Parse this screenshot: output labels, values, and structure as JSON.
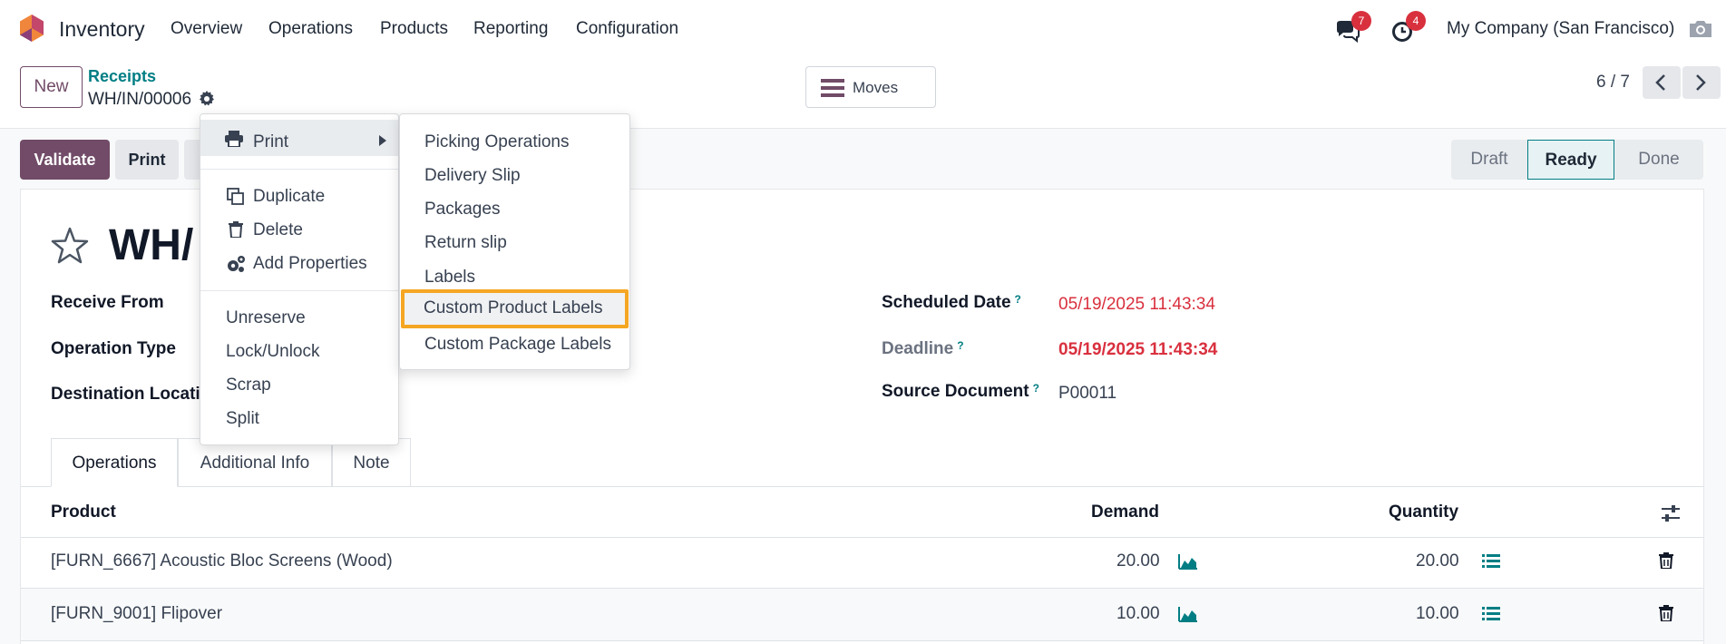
{
  "nav": {
    "app_name": "Inventory",
    "menu": [
      "Overview",
      "Operations",
      "Products",
      "Reporting",
      "Configuration"
    ],
    "messages_count": "7",
    "activities_count": "4",
    "company": "My Company (San Francisco)"
  },
  "control": {
    "new_label": "New",
    "breadcrumb_parent": "Receipts",
    "breadcrumb_current": "WH/IN/00006",
    "moves_label": "Moves",
    "pager": "6 / 7"
  },
  "actions": {
    "validate_label": "Validate",
    "print_label": "Print"
  },
  "status": {
    "stages": [
      "Draft",
      "Ready",
      "Done"
    ],
    "current": "Ready"
  },
  "form": {
    "title": "WH/",
    "receive_from_label": "Receive From",
    "operation_type_label": "Operation Type",
    "destination_label": "Destination Locatio",
    "scheduled_date_label": "Scheduled Date",
    "scheduled_date_value": "05/19/2025 11:43:34",
    "deadline_label": "Deadline",
    "deadline_value": "05/19/2025 11:43:34",
    "source_document_label": "Source Document",
    "source_document_value": "P00011",
    "tooltip_mark": "?"
  },
  "tabs": [
    "Operations",
    "Additional Info",
    "Note"
  ],
  "table": {
    "headers": {
      "product": "Product",
      "demand": "Demand",
      "quantity": "Quantity"
    },
    "rows": [
      {
        "product": "[FURN_6667] Acoustic Bloc Screens (Wood)",
        "demand": "20.00",
        "quantity": "20.00"
      },
      {
        "product": "[FURN_9001] Flipover",
        "demand": "10.00",
        "quantity": "10.00"
      }
    ]
  },
  "gear_menu": {
    "print": "Print",
    "duplicate": "Duplicate",
    "delete": "Delete",
    "add_properties": "Add Properties",
    "unreserve": "Unreserve",
    "lock_unlock": "Lock/Unlock",
    "scrap": "Scrap",
    "split": "Split"
  },
  "print_submenu": {
    "items": [
      "Picking Operations",
      "Delivery Slip",
      "Packages",
      "Return slip",
      "Labels",
      "Custom Product Labels",
      "Custom Package Labels"
    ],
    "highlighted": "Custom Product Labels"
  },
  "colors": {
    "brand": "#714b67",
    "teal": "#017e84",
    "danger": "#d9303e",
    "highlight": "#f5a623"
  }
}
